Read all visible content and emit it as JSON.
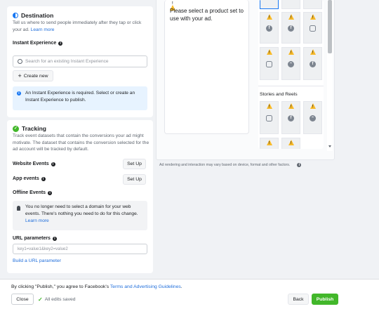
{
  "destination": {
    "title": "Destination",
    "description": "Tell us where to send people immediately after they tap or click your ad.",
    "learn_more": "Learn more",
    "instant_experience_label": "Instant Experience",
    "search_placeholder": "Search for an existing Instant Experience",
    "create_new": "Create new",
    "notice": "An Instant Experience is required. Select or create an Instant Experience to publish."
  },
  "tracking": {
    "title": "Tracking",
    "description": "Track event datasets that contain the conversions your ad might motivate. The dataset that contains the conversion selected for the ad account will be tracked by default.",
    "website_events": "Website Events",
    "app_events": "App events",
    "offline_events": "Offline Events",
    "set_up": "Set Up",
    "offline_notice": "You no longer need to select a domain for your web events. There's nothing you need to do for this change.",
    "learn_more": "Learn more",
    "url_params_label": "URL parameters",
    "url_params_placeholder": "key1=value1&key2=value2",
    "build_url": "Build a URL parameter"
  },
  "preview": {
    "message": "Please select a product set to use with your ad.",
    "stories_reels": "Stories and Reels",
    "disclaimer": "Ad rendering and interaction may vary based on device, format and other factors.",
    "placements_top": [
      "facebook",
      "facebook",
      "instagram",
      "instagram",
      "messenger",
      "facebook"
    ],
    "placements_stories": [
      "instagram",
      "facebook",
      "messenger",
      "instagram",
      "facebook"
    ]
  },
  "footer": {
    "terms_prefix": "By clicking \"Publish,\" you agree to Facebook's ",
    "terms_link": "Terms and Advertising Guidelines",
    "terms_suffix": ".",
    "close": "Close",
    "saved": "All edits saved",
    "back": "Back",
    "publish": "Publish"
  },
  "colors": {
    "accent": "#216fdb",
    "publish": "#42b72a",
    "warning": "#f7b928"
  }
}
